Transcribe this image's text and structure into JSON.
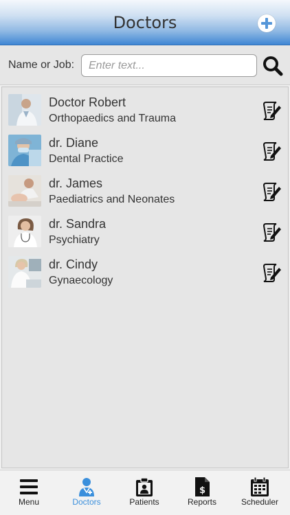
{
  "header": {
    "title": "Doctors"
  },
  "search": {
    "label": "Name or Job:",
    "placeholder": "Enter text..."
  },
  "doctors": [
    {
      "name": "Doctor Robert",
      "job": "Orthopaedics and Trauma"
    },
    {
      "name": "dr. Diane",
      "job": "Dental Practice"
    },
    {
      "name": "dr. James",
      "job": "Paediatrics and Neonates"
    },
    {
      "name": "dr. Sandra",
      "job": "Psychiatry"
    },
    {
      "name": "dr. Cindy",
      "job": "Gynaecology"
    }
  ],
  "tabs": [
    {
      "label": "Menu",
      "icon": "menu-icon",
      "active": false
    },
    {
      "label": "Doctors",
      "icon": "doctor-icon",
      "active": true
    },
    {
      "label": "Patients",
      "icon": "patients-icon",
      "active": false
    },
    {
      "label": "Reports",
      "icon": "reports-icon",
      "active": false
    },
    {
      "label": "Scheduler",
      "icon": "calendar-icon",
      "active": false
    }
  ],
  "colors": {
    "accent": "#3a8fdc",
    "header_gradient_bottom": "#3f86d4"
  }
}
